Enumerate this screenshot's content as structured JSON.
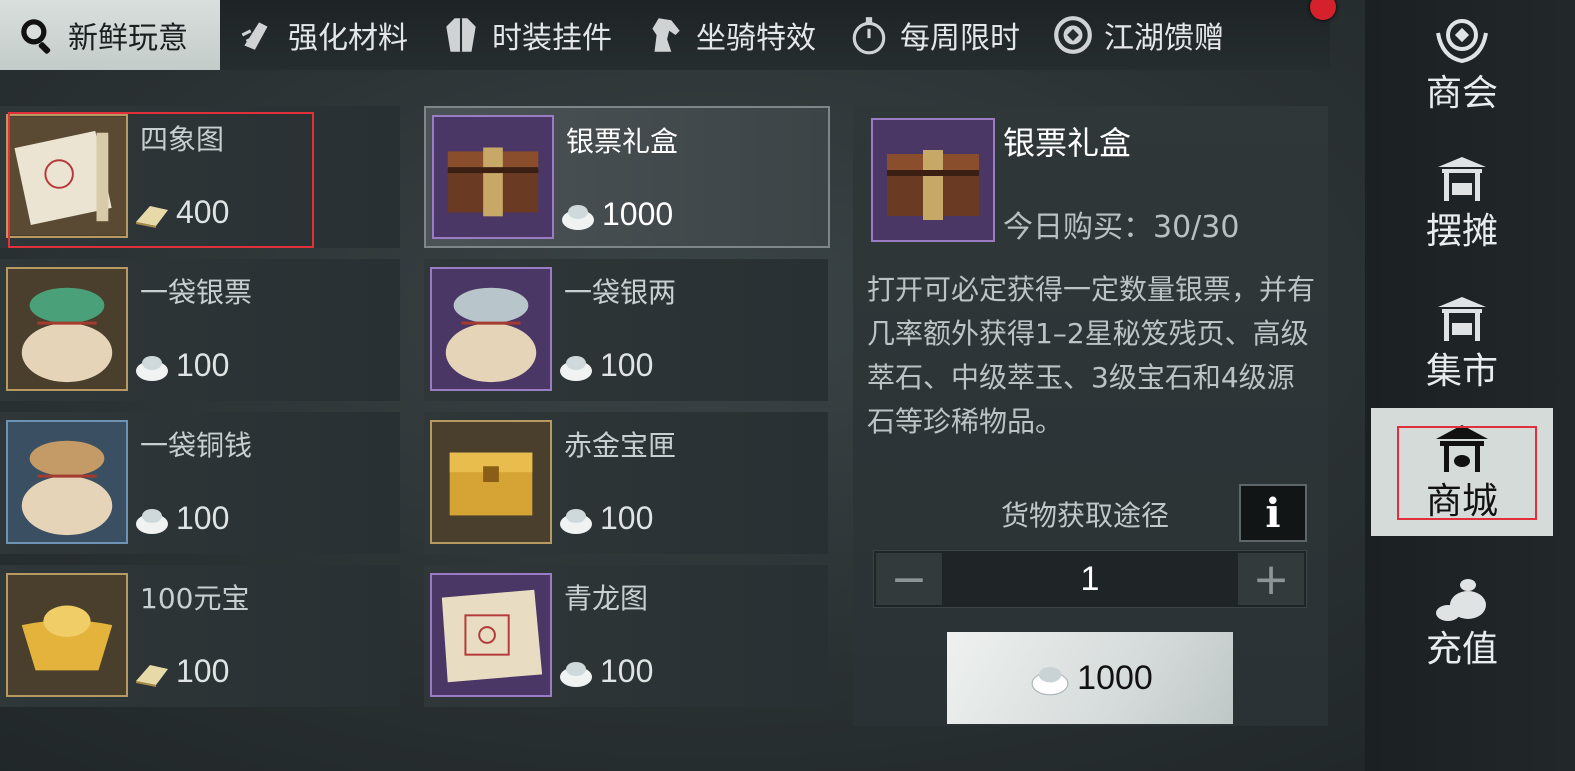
{
  "tabs": [
    {
      "label": "新鲜玩意",
      "icon": "magnifier-icon",
      "active": true
    },
    {
      "label": "强化材料",
      "icon": "material-icon",
      "active": false
    },
    {
      "label": "时装挂件",
      "icon": "robe-icon",
      "active": false
    },
    {
      "label": "坐骑特效",
      "icon": "horse-icon",
      "active": false
    },
    {
      "label": "每周限时",
      "icon": "stopwatch-icon",
      "active": false
    },
    {
      "label": "江湖馈赠",
      "icon": "coin-icon",
      "active": false
    }
  ],
  "sidenav": [
    {
      "label": "商会",
      "icon": "guild-emblem-icon",
      "active": false
    },
    {
      "label": "摆摊",
      "icon": "stall-icon",
      "active": false
    },
    {
      "label": "集市",
      "icon": "market-icon",
      "active": false
    },
    {
      "label": "商城",
      "icon": "mall-icon",
      "active": true
    },
    {
      "label": "充值",
      "icon": "money-bag-icon",
      "active": false
    }
  ],
  "items": [
    {
      "name": "四象图",
      "price": "400",
      "currency": "gold-ingot-icon",
      "rarity": "gold"
    },
    {
      "name": "银票礼盒",
      "price": "1000",
      "currency": "silver-ingot-icon",
      "rarity": "purple",
      "selected": true
    },
    {
      "name": "一袋银票",
      "price": "100",
      "currency": "silver-ingot-icon",
      "rarity": "gold"
    },
    {
      "name": "一袋银两",
      "price": "100",
      "currency": "silver-ingot-icon",
      "rarity": "purple"
    },
    {
      "name": "一袋铜钱",
      "price": "100",
      "currency": "silver-ingot-icon",
      "rarity": "blue"
    },
    {
      "name": "赤金宝匣",
      "price": "100",
      "currency": "silver-ingot-icon",
      "rarity": "gold"
    },
    {
      "name": "100元宝",
      "price": "100",
      "currency": "gold-ingot-icon",
      "rarity": "gold"
    },
    {
      "name": "青龙图",
      "price": "100",
      "currency": "silver-ingot-icon",
      "rarity": "purple"
    }
  ],
  "detail": {
    "name": "银票礼盒",
    "limit": "今日购买：30/30",
    "description": "打开可必定获得一定数量银票，并有几率额外获得1–2星秘笈残页、高级萃石、中级萃玉、3级宝石和4级源石等珍稀物品。",
    "source_label": "货物获取途径",
    "info_label": "i",
    "quantity": "1",
    "minus": "−",
    "plus": "+",
    "buy_price": "1000"
  },
  "colors": {
    "highlight_box": "#e2303a",
    "notification_dot": "#d5212c"
  }
}
